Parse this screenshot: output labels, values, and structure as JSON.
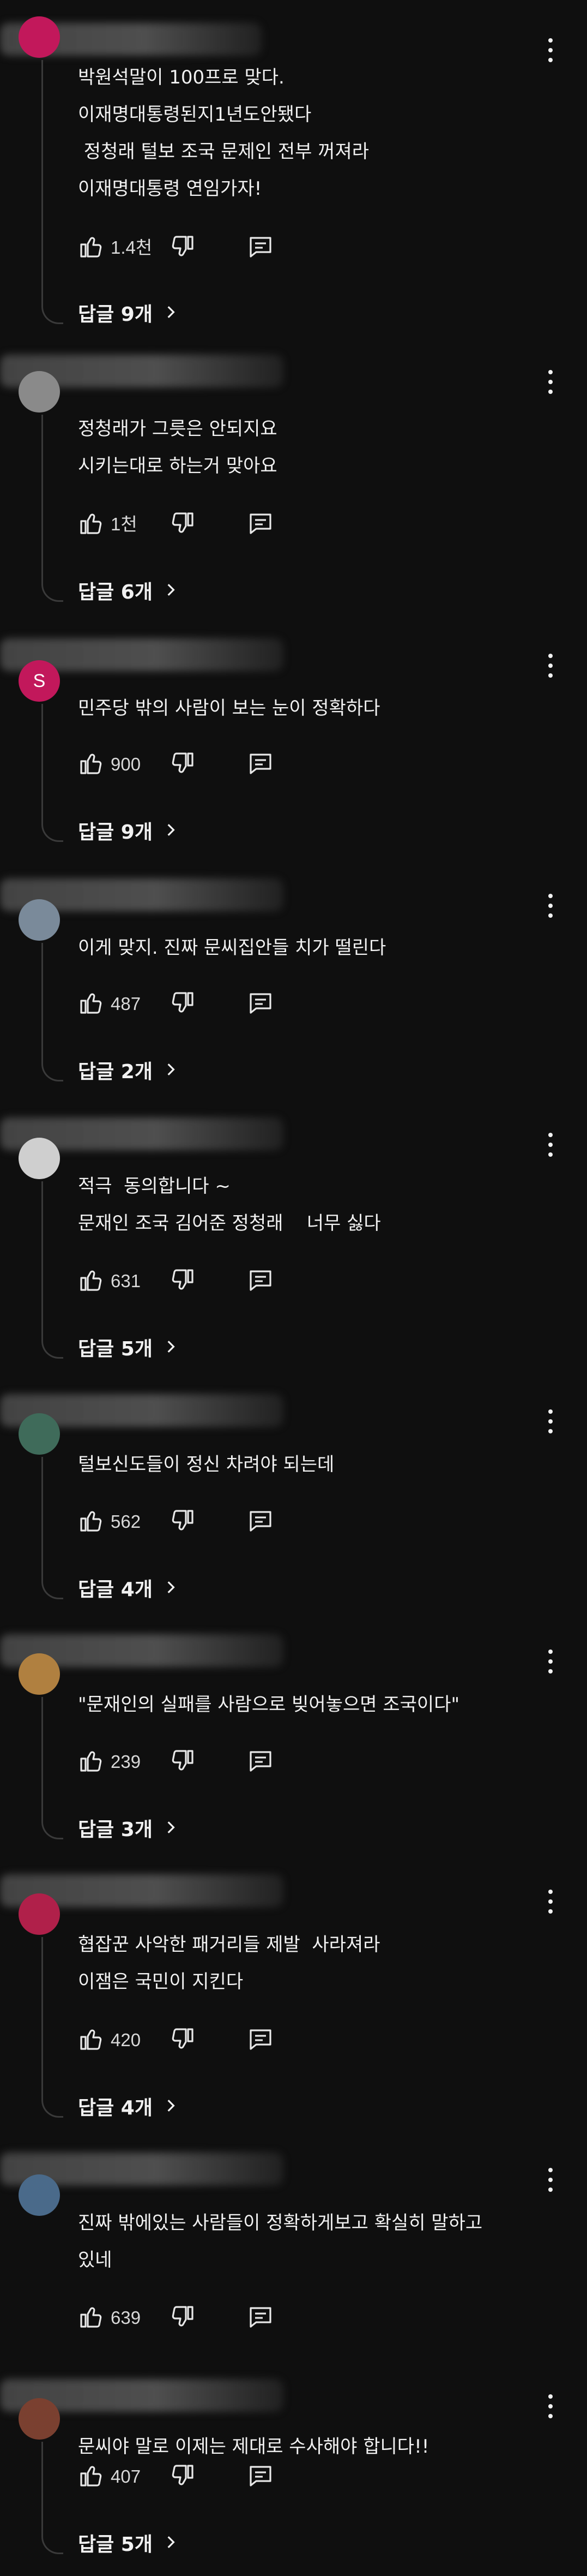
{
  "comments": [
    {
      "avatar_letter": "",
      "avatar_color": "#c2185b",
      "lines": [
        "박원석말이 100프로 맞다.",
        "이재명대통령된지1년도안됐다",
        " 정청래 털보 조국 문제인 전부 꺼져라",
        "이재명대통령 연임가자!"
      ],
      "likes": "1.4천",
      "replies": "답글 9개"
    },
    {
      "avatar_letter": "",
      "avatar_color": "#8a8a8a",
      "lines": [
        "정청래가 그릇은 안되지요",
        "시키는대로 하는거 맞아요"
      ],
      "likes": "1천",
      "replies": "답글 6개"
    },
    {
      "avatar_letter": "S",
      "avatar_color": "#c2185b",
      "lines": [
        "민주당 밖의 사람이 보는 눈이 정확하다"
      ],
      "likes": "900",
      "replies": "답글 9개"
    },
    {
      "avatar_letter": "",
      "avatar_color": "#7a8a9a",
      "lines": [
        "이게 맞지. 진짜 문씨집안들 치가 떨린다"
      ],
      "likes": "487",
      "replies": "답글 2개"
    },
    {
      "avatar_letter": "",
      "avatar_color": "#cfcfcf",
      "lines": [
        "적극  동의합니다 ~",
        "문재인 조국 김어준 정청래    너무 싫다"
      ],
      "likes": "631",
      "replies": "답글 5개"
    },
    {
      "avatar_letter": "",
      "avatar_color": "#3f6b5a",
      "lines": [
        "털보신도들이 정신 차려야 되는데"
      ],
      "likes": "562",
      "replies": "답글 4개"
    },
    {
      "avatar_letter": "",
      "avatar_color": "#b08040",
      "lines": [
        "\"문재인의 실패를 사람으로 빚어놓으면 조국이다\""
      ],
      "likes": "239",
      "replies": "답글 3개"
    },
    {
      "avatar_letter": "",
      "avatar_color": "#b0204a",
      "lines": [
        "협잡꾼 사악한 패거리들 제발  사라져라",
        "이잼은 국민이 지킨다"
      ],
      "likes": "420",
      "replies": "답글 4개"
    },
    {
      "avatar_letter": "",
      "avatar_color": "#4a6a8a",
      "lines": [
        "진짜 밖에있는 사람들이 정확하게보고 확실히 말하고",
        "있네"
      ],
      "likes": "639",
      "replies": ""
    },
    {
      "avatar_letter": "",
      "avatar_color": "#7a4030",
      "lines": [
        "문씨야 말로 이제는 제대로 수사해야 합니다!!"
      ],
      "likes": "407",
      "replies": "답글 5개"
    }
  ],
  "icons": {
    "like": "thumbs-up-icon",
    "dislike": "thumbs-down-icon",
    "reply": "comment-icon",
    "more": "more-vert-icon",
    "chevron": "chevron-right-icon"
  }
}
